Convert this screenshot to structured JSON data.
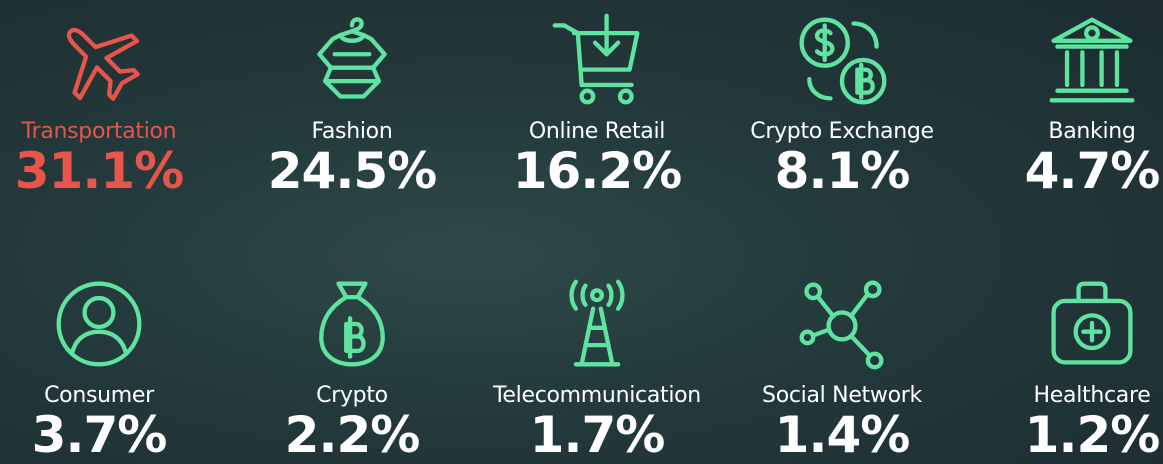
{
  "chart_data": {
    "type": "table",
    "categories": [
      "Transportation",
      "Fashion",
      "Online Retail",
      "Crypto Exchange",
      "Banking",
      "Consumer",
      "Crypto",
      "Telecommunication",
      "Social Network",
      "Healthcare"
    ],
    "values": [
      "31.1%",
      "24.5%",
      "16.2%",
      "8.1%",
      "4.7%",
      "3.7%",
      "2.2%",
      "1.7%",
      "1.4%",
      "1.2%"
    ]
  },
  "colors": {
    "highlight": "#e8554a",
    "accent": "#5fe3a1",
    "text": "#ffffff"
  },
  "items": [
    {
      "label": "Transportation",
      "value": "31.1%",
      "icon": "airplane-icon",
      "highlight": true
    },
    {
      "label": "Fashion",
      "value": "24.5%",
      "icon": "clothes-hanger-icon",
      "highlight": false
    },
    {
      "label": "Online Retail",
      "value": "16.2%",
      "icon": "shopping-cart-icon",
      "highlight": false
    },
    {
      "label": "Crypto Exchange",
      "value": "8.1%",
      "icon": "currency-exchange-icon",
      "highlight": false
    },
    {
      "label": "Banking",
      "value": "4.7%",
      "icon": "bank-icon",
      "highlight": false
    },
    {
      "label": "Consumer",
      "value": "3.7%",
      "icon": "user-icon",
      "highlight": false
    },
    {
      "label": "Crypto",
      "value": "2.2%",
      "icon": "bitcoin-bag-icon",
      "highlight": false
    },
    {
      "label": "Telecommunication",
      "value": "1.7%",
      "icon": "antenna-tower-icon",
      "highlight": false
    },
    {
      "label": "Social Network",
      "value": "1.4%",
      "icon": "network-nodes-icon",
      "highlight": false
    },
    {
      "label": "Healthcare",
      "value": "1.2%",
      "icon": "medical-kit-icon",
      "highlight": false
    }
  ]
}
